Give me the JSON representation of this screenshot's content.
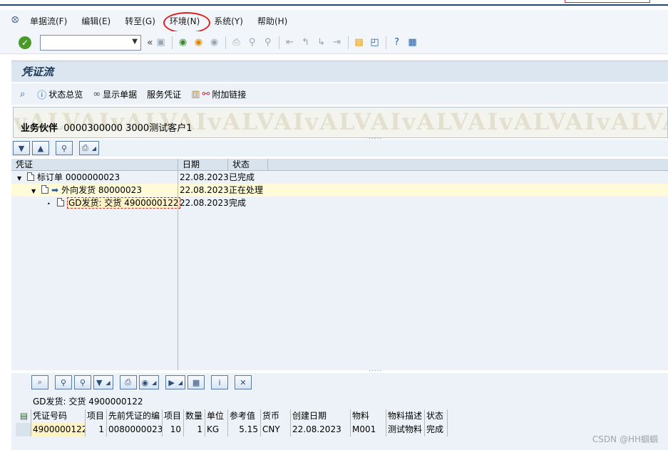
{
  "menubar": {
    "items": [
      {
        "label": "单据流(F)"
      },
      {
        "label": "编辑(E)"
      },
      {
        "label": "转至(G)"
      },
      {
        "label": "环境(N)"
      },
      {
        "label": "系统(Y)"
      },
      {
        "label": "帮助(H)"
      }
    ]
  },
  "toolbar": {
    "command_value": "",
    "prev_glyph": "«"
  },
  "title": "凭证流",
  "app_toolbar": {
    "status_overview": "状态总览",
    "display_doc": "显示单据",
    "service_doc": "服务凭证",
    "attach_link": "附加链接"
  },
  "header": {
    "bp_label": "业务伙伴",
    "bp_value": "0000300000 3000测试客户1",
    "bg_text": "vALVAIvALVAIvALVAIvALVAIvALVAIvALVAIvALVAIvALVAI"
  },
  "tree": {
    "columns": {
      "doc": "凭证",
      "date": "日期",
      "status": "状态"
    },
    "rows": [
      {
        "doc": "标订单 0000000023",
        "date": "22.08.2023",
        "status": "已完成"
      },
      {
        "doc": "外向发货 80000023",
        "date": "22.08.2023",
        "status": "正在处理"
      },
      {
        "doc": "GD发货: 交货 4900000122",
        "date": "22.08.2023",
        "status": "完成"
      }
    ]
  },
  "detail": {
    "title": "GD发货: 交货 4900000122",
    "columns": [
      "凭证号码",
      "项目",
      "先前凭证的编",
      "项目",
      "数量",
      "单位",
      "参考值",
      "货币",
      "创建日期",
      "物料",
      "物料描述",
      "状态"
    ],
    "row": [
      "4900000122",
      "1",
      "0080000023",
      "10",
      "1",
      "KG",
      "5.15",
      "CNY",
      "22.08.2023",
      "M001",
      "测试物料",
      "完成"
    ]
  },
  "watermark": "CSDN @HH蝈蝈",
  "colors": {
    "accent": "#1f5aa6",
    "highlight_circle": "#e02020",
    "selected": "#fff2c4"
  }
}
